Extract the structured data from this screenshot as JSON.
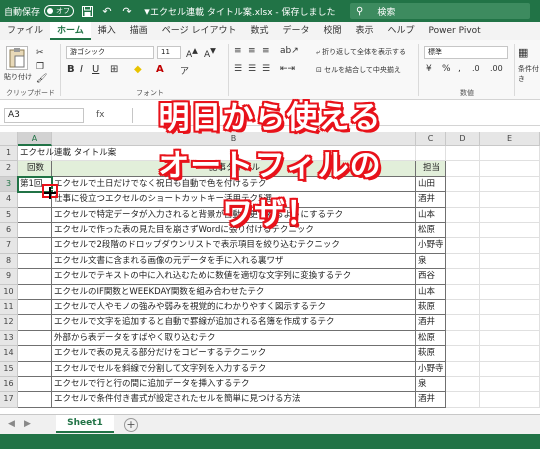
{
  "titlebar": {
    "autosave_label": "自動保存",
    "autosave_state": "オフ",
    "doc_title": "エクセル連載 タイトル案.xlsx - 保存しました",
    "search_placeholder": "検索"
  },
  "ribbon_tabs": [
    "ファイル",
    "ホーム",
    "挿入",
    "描画",
    "ページ レイアウト",
    "数式",
    "データ",
    "校閲",
    "表示",
    "ヘルプ",
    "Power Pivot"
  ],
  "active_tab": "ホーム",
  "ribbon": {
    "paste_label": "貼り付け",
    "clipboard_label": "クリップボード",
    "font_name": "游ゴシック",
    "font_size": "11",
    "font_group_label": "フォント",
    "wrap_text": "折り返して全体を表示する",
    "merge_center": "セルを結合して中央揃え",
    "number_format": "標準",
    "number_group_label": "数値",
    "cond_format": "条件付き"
  },
  "formula_bar": {
    "name_box": "A3",
    "fx": "fx"
  },
  "columns": [
    "A",
    "B",
    "C",
    "D",
    "E"
  ],
  "rows": [
    "1",
    "2",
    "3",
    "4",
    "5",
    "6",
    "7",
    "8",
    "9",
    "10",
    "11",
    "12",
    "13",
    "14",
    "15",
    "16",
    "17"
  ],
  "sheet": {
    "title": "エクセル連載 タイトル案",
    "header": {
      "no": "回数",
      "title": "記事タイトル",
      "owner": "担当"
    },
    "first_no": "第1回",
    "entries": [
      {
        "title": "エクセルで土日だけでなく祝日も自動で色を付けるテク",
        "owner": "山田"
      },
      {
        "title": "仕事に役立つエクセルのショートカットキー活用テク5選",
        "owner": "酒井"
      },
      {
        "title": "エクセルで特定データが入力されると背景が自動変更されるようにするテク",
        "owner": "山本"
      },
      {
        "title": "エクセルで作った表の見た目を崩さずWordに張り付けるテクニック",
        "owner": "松原"
      },
      {
        "title": "エクセルで2段階のドロップダウンリストで表示項目を絞り込むテクニック",
        "owner": "小野寺"
      },
      {
        "title": "エクセル文書に含まれる画像の元データを手に入れる裏ワザ",
        "owner": "泉"
      },
      {
        "title": "エクセルでテキストの中に入れ込むために数値を適切な文字列に変換するテク",
        "owner": "西谷"
      },
      {
        "title": "エクセルのIF関数とWEEKDAY関数を組み合わせたテク",
        "owner": "山本"
      },
      {
        "title": "エクセルで人やモノの強みや弱みを視覚的にわかりやすく図示するテク",
        "owner": "萩原"
      },
      {
        "title": "エクセルで文字を追加すると自動で罫線が追加される名簿を作成するテク",
        "owner": "酒井"
      },
      {
        "title": "外部から表データをすばやく取り込むテク",
        "owner": "松原"
      },
      {
        "title": "エクセルで表の見える部分だけをコピーするテクニック",
        "owner": "萩原"
      },
      {
        "title": "エクセルでセルを斜線で分割して文字列を入力するテク",
        "owner": "小野寺"
      },
      {
        "title": "エクセルで行と行の間に追加データを挿入するテク",
        "owner": "泉"
      },
      {
        "title": "エクセルで条件付き書式が設定されたセルを簡単に見つける方法",
        "owner": "酒井"
      }
    ]
  },
  "overlay": {
    "line1": "明日から使える",
    "line2": "オートフィルの",
    "line3": "ワザ！"
  },
  "sheet_tabs": {
    "active": "Sheet1",
    "add": "+"
  },
  "colors": {
    "excel_green": "#217346",
    "overlay_red": "#e8121a",
    "header_fill": "#e2efda"
  }
}
